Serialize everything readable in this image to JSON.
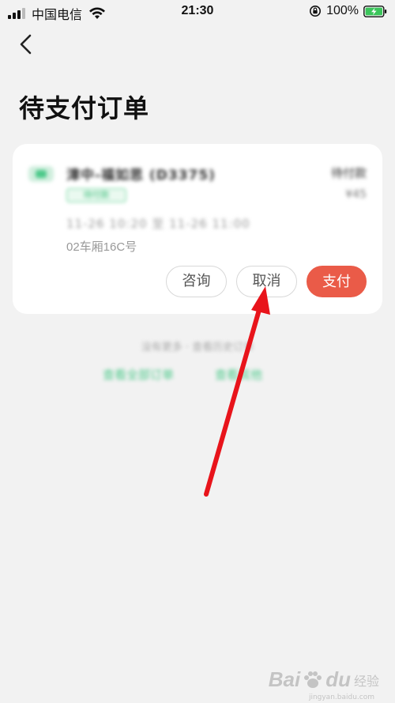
{
  "status_bar": {
    "carrier": "中国电信",
    "time": "21:30",
    "battery_percent": "100%",
    "signal_bars": 3
  },
  "nav": {
    "back_icon": "chevron-left-icon",
    "title": "待支付订单"
  },
  "order": {
    "route_name": "漳中-福如思 (D3375)",
    "status_tag": "待付款",
    "order_status": "待付款",
    "price": "¥45",
    "travel_time": "11-26 10:20 至 11-26 11:00",
    "seat_info": "02车厢16C号",
    "buttons": {
      "consult": "咨询",
      "cancel": "取消",
      "pay": "支付"
    }
  },
  "footer": {
    "note": "没有更多 · 查看历史订单",
    "link_all": "查看全部订单",
    "link_other": "查看其他"
  },
  "colors": {
    "background": "#f2f2f2",
    "pay_button": "#ea5b48",
    "accent_green": "#4cc98a",
    "annotation_arrow": "#e8141b"
  },
  "watermark": {
    "brand": "Bai",
    "brand_suffix": "du",
    "product": "经验",
    "url": "jingyan.baidu.com"
  }
}
